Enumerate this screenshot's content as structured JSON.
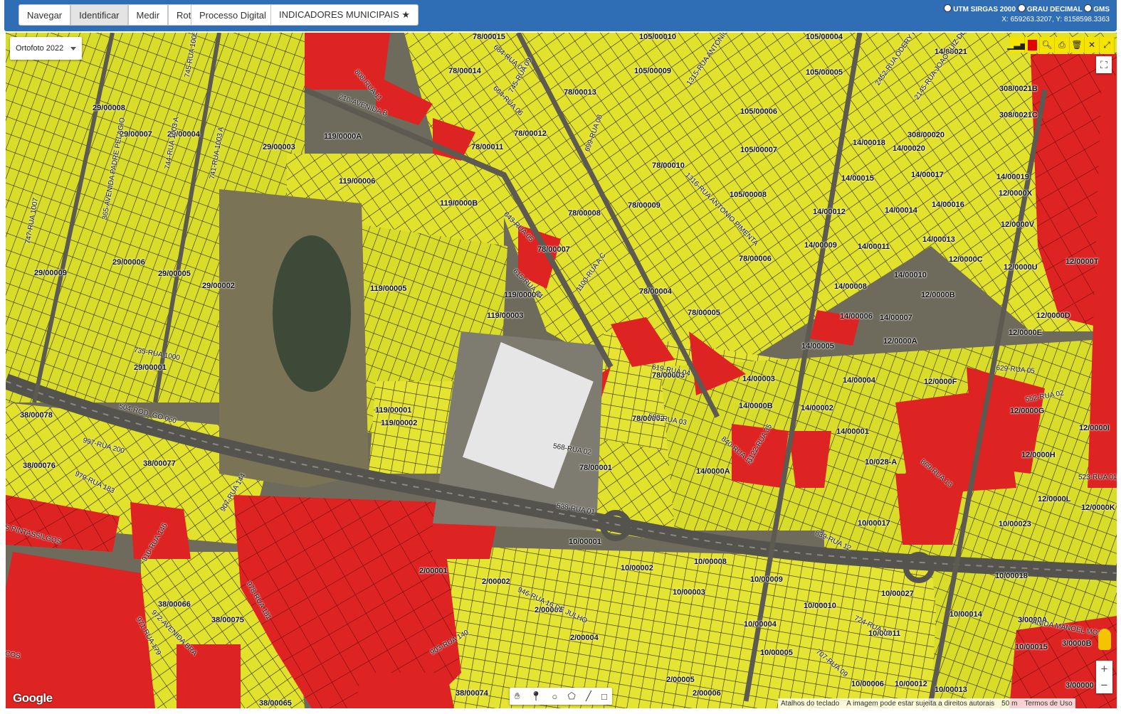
{
  "toolbar": {
    "group1": [
      "Navegar",
      "Identificar",
      "Medir",
      "Rota"
    ],
    "processo": "Processo Digital",
    "indicadores": "INDICADORES MUNICIPAIS ★"
  },
  "coords": {
    "option1": "UTM SIRGAS 2000",
    "option2": "GRAU DECIMAL",
    "option3": "GMS",
    "readout": "X: 659263.3207, Y: 8158598.3363"
  },
  "layer": {
    "selected": "Ortofoto 2022"
  },
  "lots": [
    "29/00008",
    "29/00007",
    "29/00004",
    "29/00003",
    "29/00006",
    "29/00005",
    "29/00002",
    "29/00009",
    "29/00001",
    "119/0000A",
    "119/00006",
    "119/0000B",
    "119/00005",
    "119/0000C",
    "119/00003",
    "119/00001",
    "119/00002",
    "78/00014",
    "78/00013",
    "78/00012",
    "78/00011",
    "78/00010",
    "78/00009",
    "78/00008",
    "78/00007",
    "78/00006",
    "78/00005",
    "78/00004",
    "78/00003",
    "78/00002",
    "78/00001",
    "78/00015",
    "105/00010",
    "105/00004",
    "105/00009",
    "105/00005",
    "105/00006",
    "105/00007",
    "105/00008",
    "14/00021",
    "14/00018",
    "14/00020",
    "14/00015",
    "14/00017",
    "14/00019",
    "14/00012",
    "14/00014",
    "14/00016",
    "14/00009",
    "14/00011",
    "14/00013",
    "14/00010",
    "14/00008",
    "14/00006",
    "14/00007",
    "14/00005",
    "14/00003",
    "14/00004",
    "14/0000B",
    "14/00002",
    "14/00001",
    "14/0000A",
    "308/0021B",
    "308/0021C",
    "308/00020",
    "12/0000X",
    "12/0000V",
    "12/0000T",
    "12/0000C",
    "12/0000U",
    "12/0000B",
    "12/0000D",
    "12/0000E",
    "12/0000A",
    "12/0000F",
    "12/0000G",
    "12/0000I",
    "12/0000H",
    "12/0000L",
    "12/0000K",
    "38/00078",
    "38/00076",
    "38/00077",
    "38/00066",
    "38/00075",
    "38/00074",
    "38/00065",
    "10/028-A",
    "10/00017",
    "10/00023",
    "10/00001",
    "10/00002",
    "10/00008",
    "10/00003",
    "10/00009",
    "10/00018",
    "10/00027",
    "10/00010",
    "10/00014",
    "10/00004",
    "10/00011",
    "10/00005",
    "10/00015",
    "10/00006",
    "10/00012",
    "10/00013",
    "2/00001",
    "2/00002",
    "2/00003",
    "2/00004",
    "2/00005",
    "2/00006",
    "3/0000A",
    "3/0000B",
    "3/00000"
  ],
  "streets": [
    "210-AVENIDA B",
    "808-RUA 11",
    "684-RUA 07",
    "664-RUA 06",
    "745-RUA 09",
    "699-RUA 08",
    "1315-RUA ANTONIO FRANCO",
    "2452-RUA ODERY FERREIRA",
    "2145-RUA JOAO LUIZ DE",
    "1316-RUA ANTONIO PIMENTA",
    "643-RUA 05",
    "615-RUA 04",
    "1100-RUA A C",
    "619-RUA 04",
    "568-RUA 02",
    "593-RUA 03",
    "538-RUA 01",
    "735-RUA 1000",
    "504-ROD. GO 060",
    "997-RUA 200",
    "979-RUA 183",
    "907-RUA 144",
    "910-RUA 146",
    "972-AVENIDA BRA",
    "971-RUA 179",
    "978-RUA 181",
    "903-RUA 140",
    "946-RUA 16 DE JULHO",
    "840-RUA 12",
    "1122-RUA 35",
    "839-RUA 12",
    "629-RUA 05",
    "552-RUA 02",
    "523-RUA 01",
    "869-RUA 13",
    "365-AVENIDA PADRE PELAGIO",
    "747-RUA 1007",
    "745-RUA 1005 A",
    "744-RUA 1003 A",
    "741-RUA 1003 A",
    "707-RUA 09",
    "724-RUA 10",
    "ANIDA MANOEL MONT",
    "S PINTASSILGOS",
    "COS"
  ],
  "drawing_tools": [
    "hand-icon",
    "pin-icon",
    "circle-icon",
    "polygon-icon",
    "line-icon",
    "rectangle-icon"
  ],
  "attribution": {
    "shortcuts": "Atalhos do teclado",
    "disclaimer": "A imagem pode estar sujeita a direitos autorais",
    "scale": "50 m",
    "terms": "Termos de Uso"
  },
  "brand": "Google",
  "colors": {
    "topbar": "#2f6db5",
    "lot_yellow": "#e6e629",
    "lot_red": "#e02020"
  }
}
